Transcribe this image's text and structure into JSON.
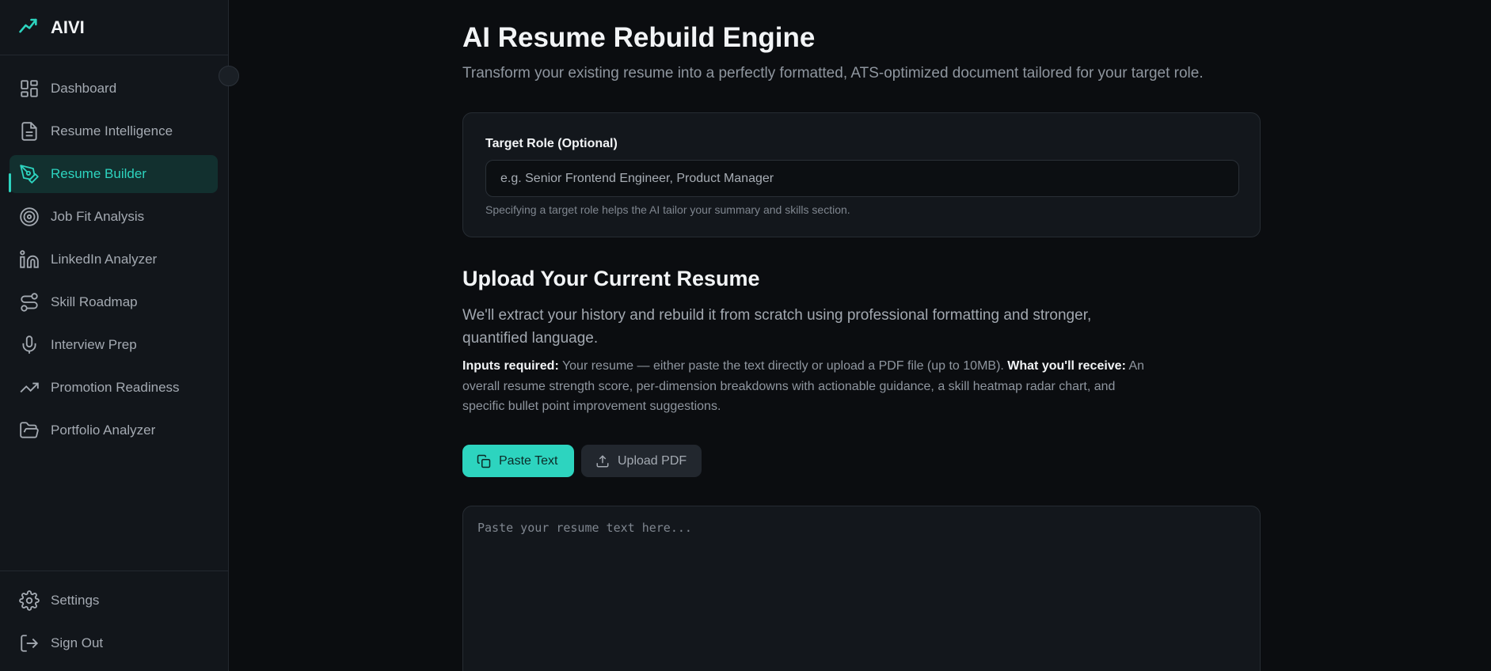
{
  "brand": {
    "name": "AIVI"
  },
  "sidebar": {
    "items": [
      {
        "label": "Dashboard",
        "icon": "dashboard-icon"
      },
      {
        "label": "Resume Intelligence",
        "icon": "document-icon"
      },
      {
        "label": "Resume Builder",
        "icon": "pen-tool-icon",
        "active": true
      },
      {
        "label": "Job Fit Analysis",
        "icon": "target-icon"
      },
      {
        "label": "LinkedIn Analyzer",
        "icon": "linkedin-icon"
      },
      {
        "label": "Skill Roadmap",
        "icon": "route-icon"
      },
      {
        "label": "Interview Prep",
        "icon": "microphone-icon"
      },
      {
        "label": "Promotion Readiness",
        "icon": "trending-up-icon"
      },
      {
        "label": "Portfolio Analyzer",
        "icon": "folder-open-icon"
      }
    ],
    "footer": [
      {
        "label": "Settings",
        "icon": "gear-icon"
      },
      {
        "label": "Sign Out",
        "icon": "sign-out-icon"
      }
    ]
  },
  "main": {
    "title": "AI Resume Rebuild Engine",
    "subtitle": "Transform your existing resume into a perfectly formatted, ATS-optimized document tailored for your target role.",
    "target_role": {
      "label": "Target Role (Optional)",
      "placeholder": "e.g. Senior Frontend Engineer, Product Manager",
      "value": "",
      "help": "Specifying a target role helps the AI tailor your summary and skills section."
    },
    "upload": {
      "title": "Upload Your Current Resume",
      "description": "We'll extract your history and rebuild it from scratch using professional formatting and stronger, quantified language.",
      "inputs_label": "Inputs required:",
      "inputs_text": " Your resume — either paste the text directly or upload a PDF file (up to 10MB). ",
      "receive_label": "What you'll receive:",
      "receive_text": " An overall resume strength score, per-dimension breakdowns with actionable guidance, a skill heatmap radar chart, and specific bullet point improvement suggestions.",
      "paste_button": "Paste Text",
      "upload_button": "Upload PDF",
      "textarea_placeholder": "Paste your resume text here...",
      "textarea_value": ""
    }
  },
  "colors": {
    "accent": "#2dd4bf",
    "background": "#0b0d10",
    "sidebar": "#12161b",
    "card": "#13171c"
  }
}
